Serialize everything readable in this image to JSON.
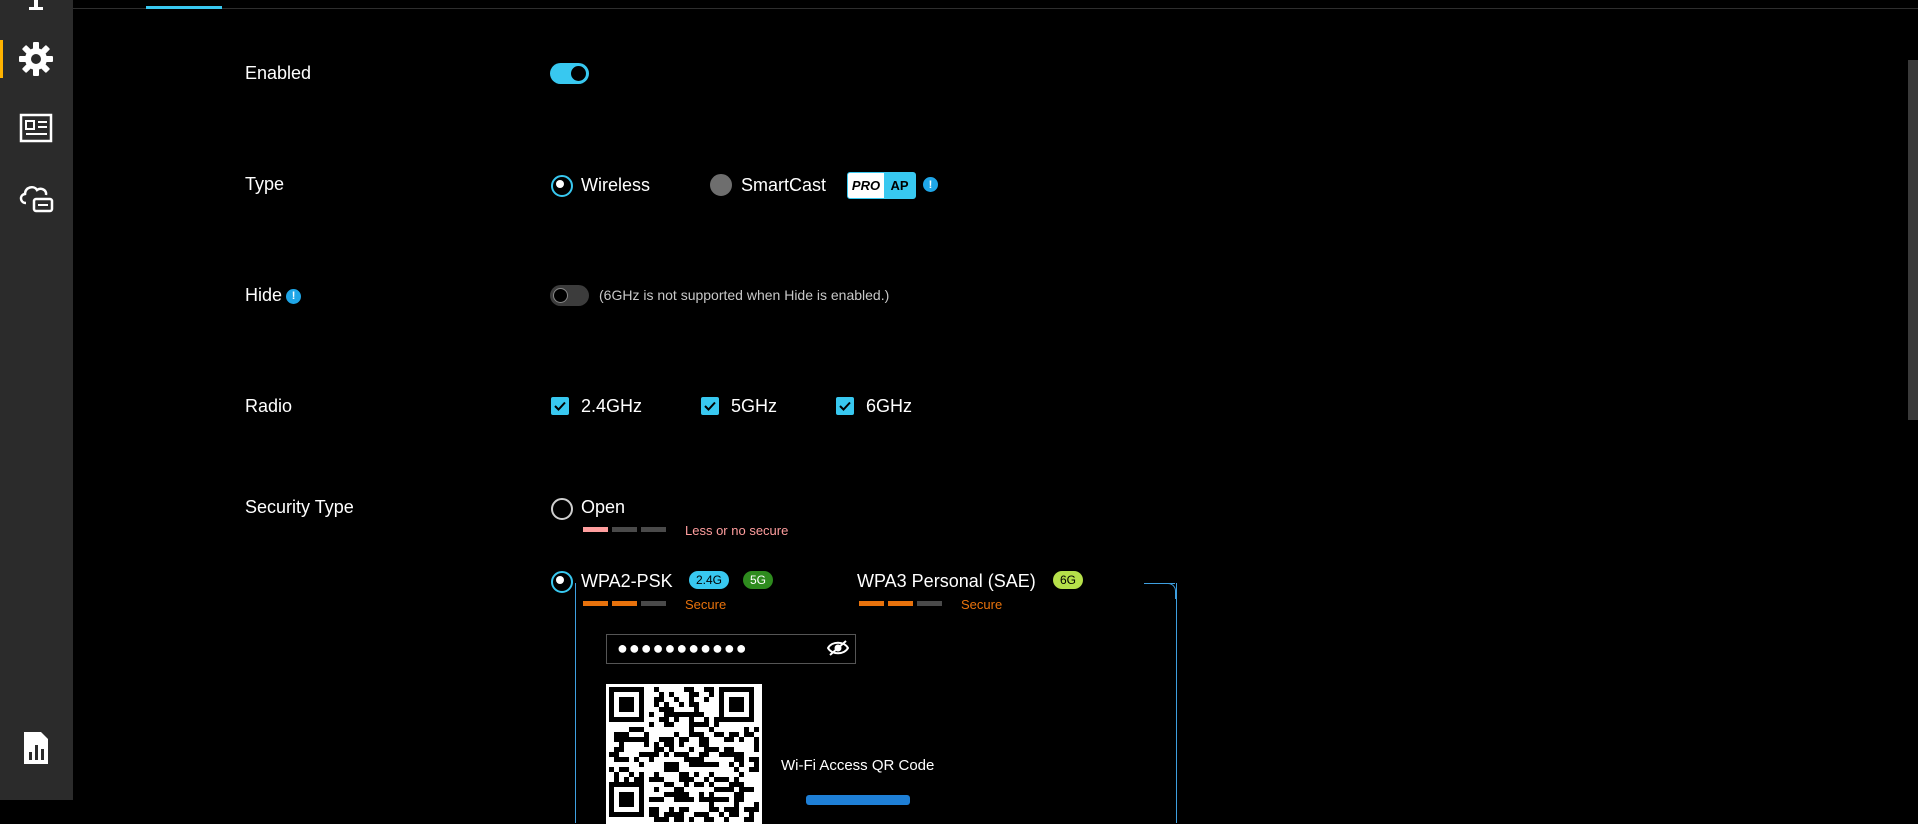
{
  "sidebar": {
    "items": [
      {
        "icon": "person-icon"
      },
      {
        "icon": "gear-icon",
        "active": true
      },
      {
        "icon": "news-icon"
      },
      {
        "icon": "cloud-sync-icon"
      },
      {
        "icon": "report-chart-icon"
      }
    ]
  },
  "form": {
    "enabled": {
      "label": "Enabled",
      "value": true
    },
    "type": {
      "label": "Type",
      "options": [
        {
          "label": "Wireless",
          "selected": true
        },
        {
          "label": "SmartCast",
          "selected": false,
          "disabled": true
        }
      ],
      "pro_badge": {
        "pro": "PRO",
        "ap": "AP"
      }
    },
    "hide": {
      "label": "Hide",
      "value": false,
      "note": "(6GHz is not supported when Hide is enabled.)"
    },
    "radio": {
      "label": "Radio",
      "options": [
        {
          "label": "2.4GHz",
          "checked": true
        },
        {
          "label": "5GHz",
          "checked": true
        },
        {
          "label": "6GHz",
          "checked": true
        }
      ]
    },
    "security_type": {
      "label": "Security Type",
      "open": {
        "label": "Open",
        "selected": false,
        "strength_text": "Less or no secure",
        "strength": 1
      },
      "wpa2": {
        "label": "WPA2-PSK",
        "selected": true,
        "badges": [
          "2.4G",
          "5G"
        ],
        "strength_text": "Secure",
        "strength": 2
      },
      "wpa3": {
        "label": "WPA3 Personal (SAE)",
        "badges": [
          "6G"
        ],
        "strength_text": "Secure",
        "strength": 2
      }
    },
    "password": {
      "value": "●●●●●●●●●●●"
    },
    "qr": {
      "label": "Wi-Fi Access QR Code"
    }
  },
  "colors": {
    "accent": "#38c8f0",
    "secure": "#e8720c",
    "weak": "#ff9e9e",
    "badge_5g": "#2e8b1e",
    "badge_6g": "#b6e04a",
    "sidebar_active": "#ffb300"
  }
}
